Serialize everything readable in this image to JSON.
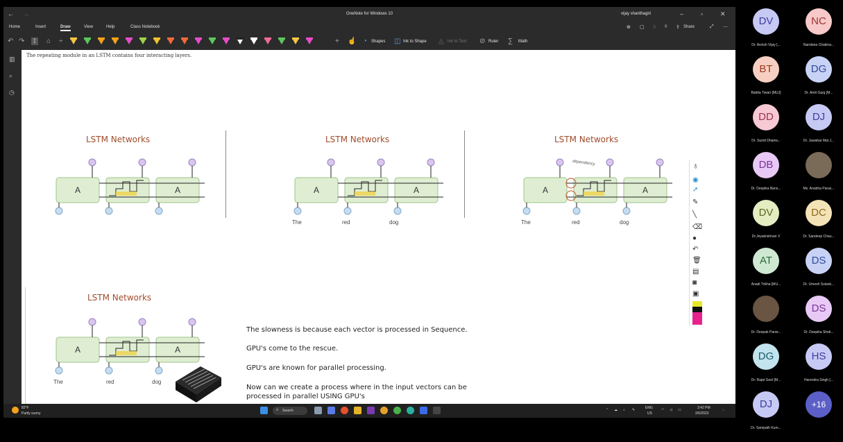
{
  "window": {
    "title": "OneNote for Windows 10",
    "user": "vijay shanthagiri",
    "share_label": "Share"
  },
  "menu": {
    "tabs": [
      "Home",
      "Insert",
      "Draw",
      "View",
      "Help",
      "Class Notebook"
    ],
    "active_tab": "Draw"
  },
  "toolbar": {
    "shapes_label": "Shapes",
    "ink_to_shape_label": "Ink to Shape",
    "ink_to_text_label": "Ink to Text",
    "ruler_label": "Ruler",
    "math_label": "Math",
    "pen_colors": [
      "#f4c542",
      "#5cc85c",
      "#f4a21a",
      "#f4a21a",
      "#e84cc8",
      "#9cd44c",
      "#f2c230",
      "#f06a3a",
      "#f06a3a",
      "#e84cc8",
      "#5cc85c",
      "#e84cc8",
      "#222222",
      "#ffffff",
      "#f06a9a",
      "#5cc85c",
      "#f4c542",
      "#e84cc8"
    ]
  },
  "page": {
    "caption": "The repeating module in an LSTM contains four interacting layers.",
    "diagram_title": "LSTM Networks",
    "cell_label": "A",
    "words": [
      "The",
      "red",
      "dog"
    ],
    "dependency_label": "dependency",
    "paragraphs": [
      "The slowness is because each vector is processed in Sequence.",
      "GPU's come to the rescue.",
      "GPU's are known for parallel processing.",
      "Now can we create a process where in the input vectors can be processed in parallel USING GPU's"
    ]
  },
  "taskbar": {
    "temperature": "82°F",
    "condition": "Partly sunny",
    "search_label": "Search",
    "language": "ENG",
    "region": "US",
    "time": "3:42 PM",
    "date": "2/6/2023"
  },
  "participants": [
    {
      "initials": "DV",
      "name": "Dr. Avnish Vijay [...",
      "color": "#c7c9f5",
      "text_color": "#3b3f99"
    },
    {
      "initials": "NC",
      "name": "Nandana Chakina...",
      "color": "#f7c9c9",
      "text_color": "#9a3232"
    },
    {
      "initials": "BT",
      "name": "Babita Tiwari [MUJ]",
      "color": "#f7cfc2",
      "text_color": "#9a3a22"
    },
    {
      "initials": "DG",
      "name": "Dr. Amit Garg [M...",
      "color": "#c7d2f5",
      "text_color": "#324a9a"
    },
    {
      "initials": "DD",
      "name": "Dr. Sumit Dhariw...",
      "color": "#f7c9d4",
      "text_color": "#9a3250"
    },
    {
      "initials": "DJ",
      "name": "Dr. Jawahar Mal J...",
      "color": "#c7c9f5",
      "text_color": "#3b3f99"
    },
    {
      "initials": "DB",
      "name": "Dr. Deepika Bans...",
      "color": "#e8c9f5",
      "text_color": "#7a329a"
    },
    {
      "initials": "",
      "name": "Ms. Anubha Paras...",
      "color": "#7a6a58",
      "text_color": "#ffffff"
    },
    {
      "initials": "DV",
      "name": "Dr.Jeyakrishnan V",
      "color": "#e4ecc2",
      "text_color": "#5a6a22"
    },
    {
      "initials": "DC",
      "name": "Dr. Sandeep Chau...",
      "color": "#f5e3b8",
      "text_color": "#8a6a1a"
    },
    {
      "initials": "AT",
      "name": "Anadi Trikha [MU...",
      "color": "#cfe8d2",
      "text_color": "#2a6a3a"
    },
    {
      "initials": "DS",
      "name": "Dr. Umesh Solank...",
      "color": "#c7d2f5",
      "text_color": "#324a9a"
    },
    {
      "initials": "",
      "name": "Dr. Deepak Panw...",
      "color": "#6a5442",
      "text_color": "#ffffff"
    },
    {
      "initials": "DS",
      "name": "Dr. Deepika Shek...",
      "color": "#e8c9f5",
      "text_color": "#7a329a"
    },
    {
      "initials": "DG",
      "name": "Dr. Rajat Goel [M...",
      "color": "#c2e4ee",
      "text_color": "#1e5a6a"
    },
    {
      "initials": "HS",
      "name": "Harendra Singh [...",
      "color": "#c7c9f5",
      "text_color": "#3b3f99"
    },
    {
      "initials": "DJ",
      "name": "Dr. Sampath Kum...",
      "color": "#c7c9f5",
      "text_color": "#3b3f99"
    },
    {
      "initials": "+16",
      "name": "",
      "color": "#5b5fc7",
      "text_color": "#ffffff"
    }
  ]
}
